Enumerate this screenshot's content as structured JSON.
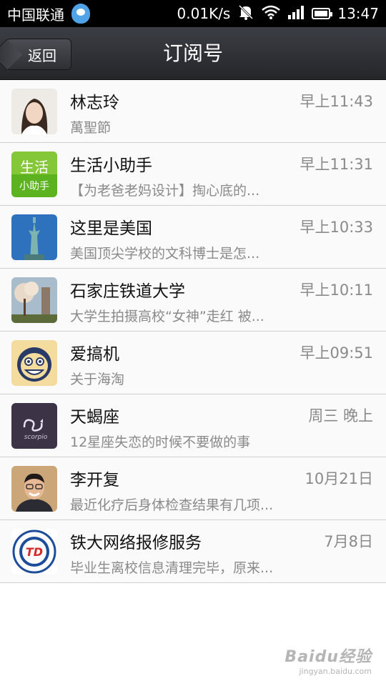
{
  "status_bar": {
    "carrier": "中国联通",
    "speed": "0.01K/s",
    "time": "13:47",
    "icons": [
      "qq-icon",
      "mute-icon",
      "wifi-icon",
      "signal-icon",
      "battery-icon"
    ]
  },
  "header": {
    "back_label": "返回",
    "title": "订阅号"
  },
  "items": [
    {
      "name": "林志玲",
      "time": "早上11:43",
      "preview": "萬聖節",
      "avatar": "avatar-portrait",
      "color": "#e8e4e0"
    },
    {
      "name": "生活小助手",
      "time": "早上11:31",
      "preview": "【为老爸老妈设计】掏心底的...",
      "avatar": "avatar-life-helper",
      "color": "#58b21e",
      "avatar_text1": "生活",
      "avatar_text2": "小助手"
    },
    {
      "name": "这里是美国",
      "time": "早上10:33",
      "preview": "美国顶尖学校的文科博士是怎...",
      "avatar": "avatar-statue-of-liberty",
      "color": "#2d6fb8"
    },
    {
      "name": "石家庄铁道大学",
      "time": "早上10:11",
      "preview": "大学生拍摄高校“女神”走红 被...",
      "avatar": "avatar-campus",
      "color": "#8aa0b5"
    },
    {
      "name": "爱搞机",
      "time": "早上09:51",
      "preview": "关于海淘",
      "avatar": "avatar-cartoon-face",
      "color": "#f2d89a"
    },
    {
      "name": "天蝎座",
      "time": "周三 晚上",
      "preview": "12星座失恋的时候不要做的事",
      "avatar": "avatar-scorpio",
      "color": "#3c3346",
      "avatar_text1": "scorpio"
    },
    {
      "name": "李开复",
      "time": "10月21日",
      "preview": "最近化疗后身体检查结果有几项...",
      "avatar": "avatar-portrait-man",
      "color": "#c9a77f"
    },
    {
      "name": "铁大网络报修服务",
      "time": "7月8日",
      "preview": "毕业生离校信息清理完毕，原来...",
      "avatar": "avatar-td-logo",
      "color": "#1d4c9a",
      "avatar_text1": "TD"
    }
  ],
  "watermark": {
    "main": "Baidu经验",
    "sub": "jingyan.baidu.com"
  }
}
